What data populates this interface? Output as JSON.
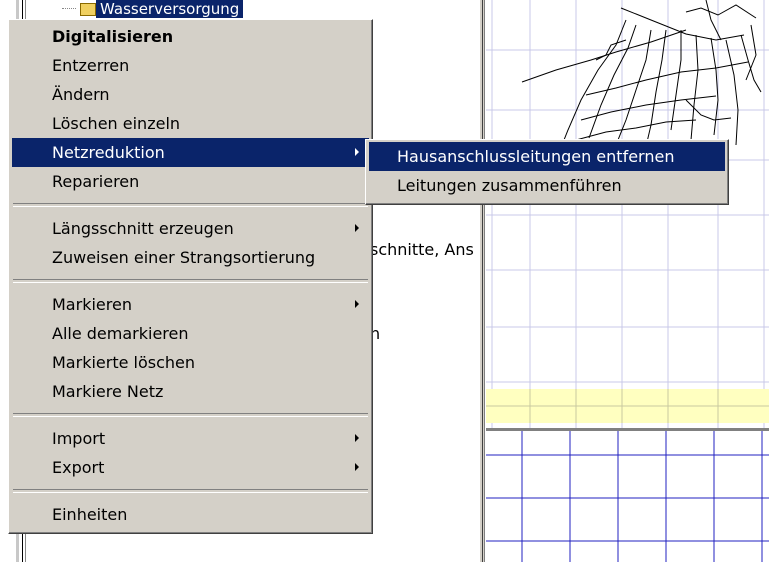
{
  "tree": {
    "node_label": "Wasserversorgung"
  },
  "background_text": {
    "fragment_1": "schnitte, Ans",
    "fragment_2": "h"
  },
  "context_menu": {
    "items": [
      {
        "label": "Digitalisieren",
        "bold": true
      },
      {
        "label": "Entzerren"
      },
      {
        "label": "Ändern"
      },
      {
        "label": "Löschen einzeln"
      },
      {
        "label": "Netzreduktion",
        "submenu": true,
        "selected": true
      },
      {
        "label": "Reparieren"
      },
      {
        "label": "Längsschnitt erzeugen",
        "submenu": true
      },
      {
        "label": "Zuweisen einer Strangsortierung"
      },
      {
        "label": "Markieren",
        "submenu": true
      },
      {
        "label": "Alle demarkieren"
      },
      {
        "label": "Markierte löschen"
      },
      {
        "label": "Markiere Netz"
      },
      {
        "label": "Import",
        "submenu": true
      },
      {
        "label": "Export",
        "submenu": true
      },
      {
        "label": "Einheiten"
      }
    ]
  },
  "submenu": {
    "items": [
      {
        "label": "Hausanschlussleitungen entfernen",
        "selected": true
      },
      {
        "label": "Leitungen zusammenführen"
      }
    ]
  },
  "colors": {
    "menu_bg": "#d4d0c8",
    "selection": "#0a246a",
    "grid_top": "#c8c8e8",
    "grid_bottom": "#2020c0",
    "yellow_band": "#ffffc0"
  }
}
